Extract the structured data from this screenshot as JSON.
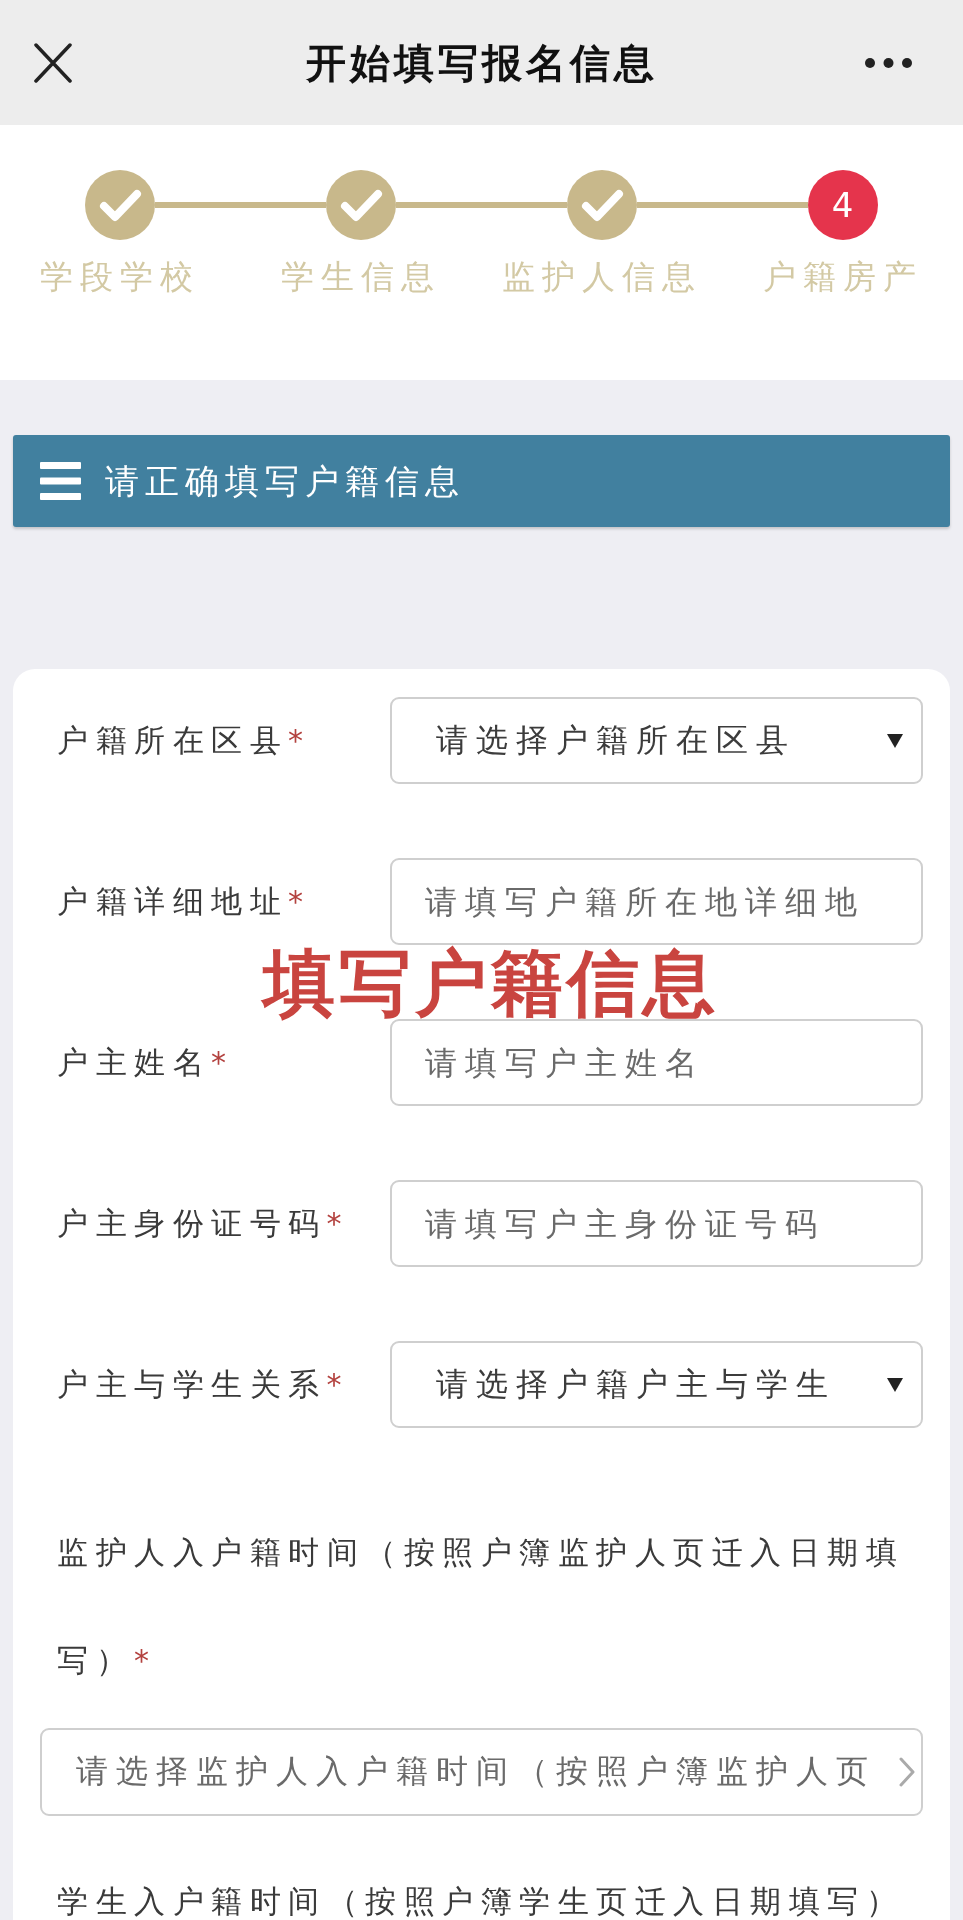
{
  "header": {
    "title": "开始填写报名信息"
  },
  "steps": [
    {
      "label": "学段学校",
      "completed": true
    },
    {
      "label": "学生信息",
      "completed": true
    },
    {
      "label": "监护人信息",
      "completed": true
    },
    {
      "label": "户籍房产",
      "completed": false,
      "number": "4"
    }
  ],
  "section": {
    "title": "请正确填写户籍信息"
  },
  "annotation": "填写户籍信息",
  "fields": [
    {
      "kind": "select",
      "label": "户籍所在区县",
      "required_mark": "*",
      "placeholder": "请选择户籍所在区县"
    },
    {
      "kind": "input",
      "label": "户籍详细地址",
      "required_mark": "*",
      "placeholder": "请填写户籍所在地详细地"
    },
    {
      "kind": "input",
      "label": "户主姓名",
      "required_mark": "*",
      "placeholder": "请填写户主姓名"
    },
    {
      "kind": "input",
      "label": "户主身份证号码",
      "required_mark": "*",
      "placeholder": "请填写户主身份证号码"
    },
    {
      "kind": "select",
      "label": "户主与学生关系",
      "required_mark": "*",
      "placeholder": "请选择户籍户主与学生"
    },
    {
      "kind": "picker",
      "label": "监护人入户籍时间（按照户簿监护人页迁入日期填写）",
      "required_mark": "*",
      "placeholder": "请选择监护人入户籍时间（按照户簿监护人页"
    },
    {
      "kind": "picker",
      "label": "学生入户籍时间（按照户簿学生页迁入日期填写）"
    }
  ]
}
